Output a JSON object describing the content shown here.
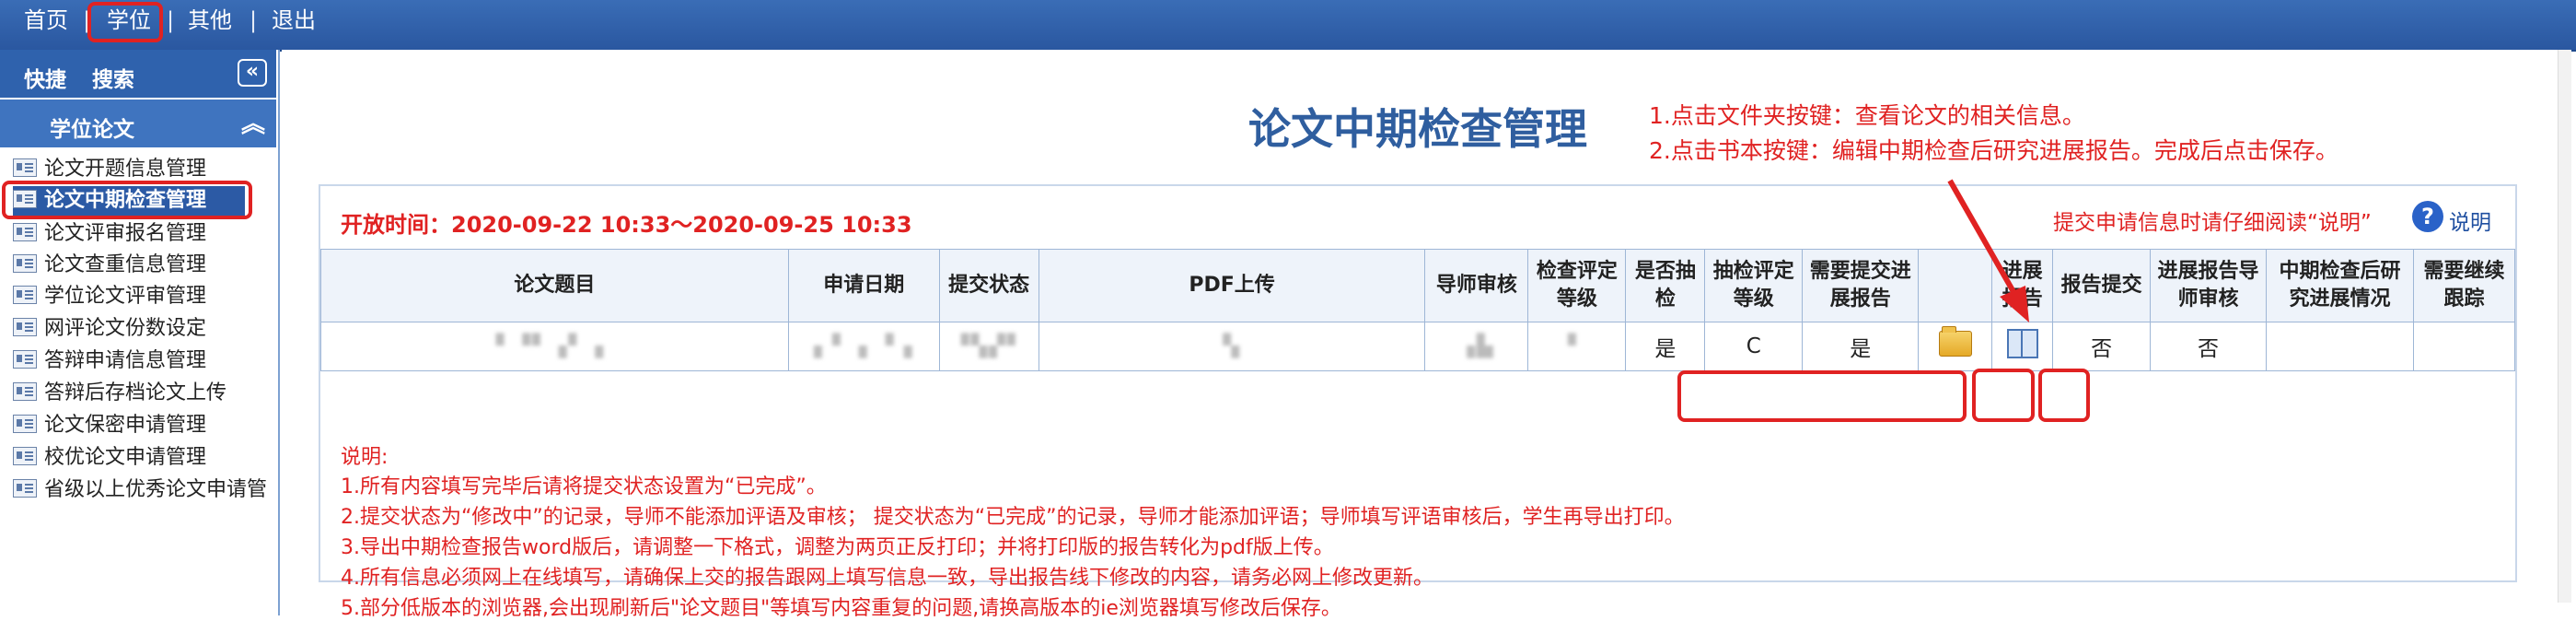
{
  "topnav": {
    "items": [
      "首页",
      "学位",
      "其他",
      "退出"
    ],
    "separator": "|"
  },
  "sidebar": {
    "header1": {
      "quick": "快捷",
      "search": "搜索",
      "collapse_icon": "double-chevron-left-icon"
    },
    "header2": {
      "title": "学位论文",
      "collapse_icon": "double-chevron-up-icon"
    },
    "items": [
      "论文开题信息管理",
      "论文中期检查管理",
      "论文评审报名管理",
      "论文查重信息管理",
      "学位论文评审管理",
      "网评论文份数设定",
      "答辩申请信息管理",
      "答辩后存档论文上传",
      "论文保密申请管理",
      "校优论文申请管理",
      "省级以上优秀论文申请管"
    ],
    "active_index": 1
  },
  "main": {
    "title": "论文中期检查管理",
    "instructions": [
      "1.点击文件夹按键：查看论文的相关信息。",
      "2.点击书本按键：编辑中期检查后研究进展报告。完成后点击保存。"
    ],
    "open_time_label": "开放时间：",
    "open_time_value": "2020-09-22 10:33～2020-09-25 10:33",
    "notice": "提交申请信息时请仔细阅读“说明”",
    "help_label": "说明",
    "table": {
      "headers": [
        "论文题目",
        "申请日期",
        "提交状态",
        "PDF上传",
        "导师审核",
        "检查评定等级",
        "是否抽检",
        "抽检评定等级",
        "需要提交进展报告",
        "",
        "进展报告",
        "报告提交",
        "进展报告导师审核",
        "中期检查后研究进展情况",
        "需要继续跟踪"
      ],
      "row": {
        "title": "▘▝▘▗▘ ▖",
        "apply_date": "▗ ▘▗ ▝ ▖",
        "submit_state": "▝▚▞▘",
        "pdf": "▚",
        "tutor_review": "▗▙",
        "grade": "▘",
        "sampled": "是",
        "sample_grade": "C",
        "need_report": "是",
        "folder_icon": "folder-open-icon",
        "book_icon": "book-icon",
        "report_submitted": "否",
        "report_tutor_review": "否",
        "progress": "",
        "follow_up": ""
      }
    },
    "notes": [
      "说明:",
      "1.所有内容填写完毕后请将提交状态设置为“已完成”。",
      "2.提交状态为“修改中”的记录，导师不能添加评语及审核；  提交状态为“已完成”的记录，导师才能添加评语；导师填写评语审核后，学生再导出打印。",
      "3.导出中期检查报告word版后，请调整一下格式，调整为两页正反打印；并将打印版的报告转化为pdf版上传。",
      "4.所有信息必须网上在线填写，请确保上交的报告跟网上填写信息一致，导出报告线下修改的内容，请务必网上修改更新。",
      "5.部分低版本的浏览器,会出现刷新后\"论文题目\"等填写内容重复的问题,请换高版本的ie浏览器填写修改后保存。"
    ]
  },
  "colors": {
    "nav_blue": "#2a57a0",
    "annotation_red": "#e02222",
    "title_blue": "#2f5e9f"
  }
}
